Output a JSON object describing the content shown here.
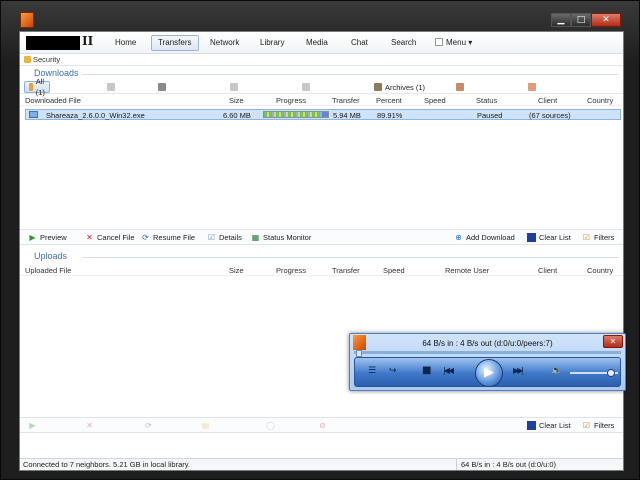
{
  "window": {
    "app_logo_tag": "II",
    "controls": {
      "minimize": "▁",
      "maximize": "□",
      "close": "✕"
    }
  },
  "nav": {
    "items": [
      {
        "label": "Home",
        "active": false
      },
      {
        "label": "Transfers",
        "active": true
      },
      {
        "label": "Network",
        "active": false
      },
      {
        "label": "Library",
        "active": false
      },
      {
        "label": "Media",
        "active": false
      },
      {
        "label": "Chat",
        "active": false
      },
      {
        "label": "Search",
        "active": false
      }
    ],
    "menu": "Menu",
    "menu_arrow": "▾"
  },
  "security": {
    "label": "Security"
  },
  "downloads": {
    "title": "Downloads",
    "filters": [
      {
        "label": "All (1)",
        "active": true,
        "enabled": true
      },
      {
        "label": "",
        "active": false,
        "enabled": false
      },
      {
        "label": "",
        "active": false,
        "enabled": false
      },
      {
        "label": "",
        "active": false,
        "enabled": false
      },
      {
        "label": "",
        "active": false,
        "enabled": false
      },
      {
        "label": "Archives (1)",
        "active": false,
        "enabled": true
      },
      {
        "label": "",
        "active": false,
        "enabled": false
      },
      {
        "label": "",
        "active": false,
        "enabled": false
      }
    ],
    "columns": {
      "file": "Downloaded File",
      "size": "Size",
      "progress": "Progress",
      "transfer": "Transfer",
      "percent": "Percent",
      "speed": "Speed",
      "status": "Status",
      "client": "Client",
      "country": "Country"
    },
    "rows": [
      {
        "file": "Shareaza_2.6.0.0_Win32.exe",
        "size": "6.60 MB",
        "progress_percent": 89.91,
        "transfer": "5.94 MB",
        "percent": "89.91%",
        "speed": "",
        "status": "Paused",
        "client": "(67 sources)",
        "country": ""
      }
    ],
    "toolbar": {
      "preview": "Preview",
      "cancel": "Cancel File",
      "resume": "Resume File",
      "details": "Details",
      "monitor": "Status Monitor",
      "add": "Add Download",
      "clear": "Clear List",
      "filters": "Filters"
    }
  },
  "uploads": {
    "title": "Uploads",
    "columns": {
      "file": "Uploaded File",
      "size": "Size",
      "progress": "Progress",
      "transfer": "Transfer",
      "speed": "Speed",
      "remote": "Remote User",
      "client": "Client",
      "country": "Country"
    },
    "toolbar": {
      "clear": "Clear List",
      "filters": "Filters"
    }
  },
  "statusbar": {
    "left": "Connected to 7 neighbors.  5.21 GB in local library.",
    "right": "64 B/s in : 4 B/s out  (d:0/u:0)"
  },
  "player": {
    "title": "64 B/s in : 4 B/s out  (d:0/u:0/peers:7)",
    "close": "✕",
    "volume_level": 0.85
  }
}
